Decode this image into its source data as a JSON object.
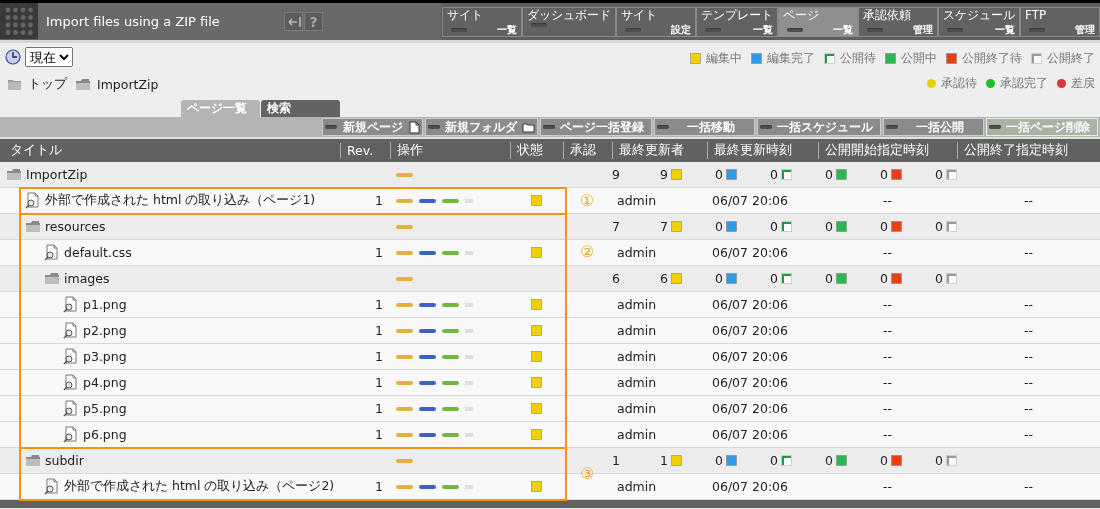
{
  "window": {
    "title": "Import files using a ZIP file",
    "help_label": "?"
  },
  "nav": [
    {
      "top": "サイト",
      "bottom": "一覧",
      "selected": false
    },
    {
      "top": "ダッシュボード",
      "selected": false
    },
    {
      "top": "サイト",
      "bottom": "設定",
      "selected": false
    },
    {
      "top": "テンプレート",
      "bottom": "一覧",
      "selected": false
    },
    {
      "top": "ページ",
      "bottom": "一覧",
      "selected": true
    },
    {
      "top": "承認依頼",
      "bottom": "管理",
      "selected": false
    },
    {
      "top": "スケジュール",
      "bottom": "一覧",
      "selected": false
    },
    {
      "top": "FTP",
      "bottom": "管理",
      "selected": false
    }
  ],
  "time_select": {
    "value": "現在"
  },
  "breadcrumbs": [
    {
      "label": "トップ",
      "kind": "closed"
    },
    {
      "label": "ImportZip",
      "kind": "open"
    }
  ],
  "legend": {
    "states": [
      {
        "label": "編集中",
        "color": "#f2d000",
        "kind": "square"
      },
      {
        "label": "編集完了",
        "color": "#2f9be6",
        "kind": "square"
      },
      {
        "label": "公開待",
        "color": "#1f9a40",
        "kind": "corner"
      },
      {
        "label": "公開中",
        "color": "#2fb552",
        "kind": "square"
      },
      {
        "label": "公開終了待",
        "color": "#e8400e",
        "kind": "square"
      },
      {
        "label": "公開終了",
        "color": "#999999",
        "kind": "corner"
      }
    ],
    "approvals": [
      {
        "label": "承認待",
        "color": "#e6d000"
      },
      {
        "label": "承認完了",
        "color": "#1fbf2a"
      },
      {
        "label": "差戻",
        "color": "#d83a3a"
      }
    ]
  },
  "tabs": [
    {
      "label": "ページ一覧",
      "selected": true
    },
    {
      "label": "検索",
      "selected": false
    }
  ],
  "toolbar": [
    {
      "label": "新規ページ",
      "kind": "new-page",
      "highlighted": false
    },
    {
      "label": "新規フォルダ",
      "kind": "new-folder",
      "highlighted": false
    },
    {
      "label": "ページ一括登録",
      "highlighted": false
    },
    {
      "label": "一括移動",
      "highlighted": false
    },
    {
      "label": "一括スケジュール",
      "highlighted": false
    },
    {
      "label": "一括公開",
      "highlighted": false
    },
    {
      "label": "一括ページ削除",
      "highlighted": true
    }
  ],
  "table": {
    "columns": [
      "タイトル",
      "Rev.",
      "操作",
      "状態",
      "承認",
      "最終更新者",
      "最終更新時刻",
      "公開開始指定時刻",
      "公開終了指定時刻"
    ],
    "rows": [
      {
        "kind": "folder",
        "title": "ImportZip",
        "total": "9",
        "counts": [
          {
            "count": "9",
            "color": "#f2d000",
            "kind": "square"
          },
          {
            "count": "0",
            "color": "#2f9be6",
            "kind": "square"
          },
          {
            "count": "0",
            "color": "#1f9a40",
            "kind": "corner"
          },
          {
            "count": "0",
            "color": "#2fb552",
            "kind": "square"
          },
          {
            "count": "0",
            "color": "#e8400e",
            "kind": "square"
          },
          {
            "count": "0",
            "color": "#999999",
            "kind": "corner"
          }
        ],
        "children": [
          {
            "kind": "page",
            "title": "外部で作成された html の取り込み（ページ1)",
            "rev": "1",
            "color": "#f2d000",
            "updater": "admin",
            "updated": "06/07 20:06",
            "publish_start": "--",
            "publish_end": "--",
            "callout": "①"
          },
          {
            "kind": "folder",
            "title": "resources",
            "total": "7",
            "callout": "②",
            "counts": [
              {
                "count": "7",
                "color": "#f2d000",
                "kind": "square"
              },
              {
                "count": "0",
                "color": "#2f9be6",
                "kind": "square"
              },
              {
                "count": "0",
                "color": "#1f9a40",
                "kind": "corner"
              },
              {
                "count": "0",
                "color": "#2fb552",
                "kind": "square"
              },
              {
                "count": "0",
                "color": "#e8400e",
                "kind": "square"
              },
              {
                "count": "0",
                "color": "#999999",
                "kind": "corner"
              }
            ],
            "children": [
              {
                "kind": "page",
                "title": "default.css",
                "rev": "1",
                "color": "#f2d000",
                "updater": "admin",
                "updated": "06/07 20:06",
                "publish_start": "--",
                "publish_end": "--"
              },
              {
                "kind": "folder",
                "title": "images",
                "total": "6",
                "counts": [
                  {
                    "count": "6",
                    "color": "#f2d000",
                    "kind": "square"
                  },
                  {
                    "count": "0",
                    "color": "#2f9be6",
                    "kind": "square"
                  },
                  {
                    "count": "0",
                    "color": "#1f9a40",
                    "kind": "corner"
                  },
                  {
                    "count": "0",
                    "color": "#2fb552",
                    "kind": "square"
                  },
                  {
                    "count": "0",
                    "color": "#e8400e",
                    "kind": "square"
                  },
                  {
                    "count": "0",
                    "color": "#999999",
                    "kind": "corner"
                  }
                ],
                "children": [
                  {
                    "kind": "page",
                    "title": "p1.png",
                    "rev": "1",
                    "color": "#f2d000",
                    "updater": "admin",
                    "updated": "06/07 20:06",
                    "publish_start": "--",
                    "publish_end": "--"
                  },
                  {
                    "kind": "page",
                    "title": "p2.png",
                    "rev": "1",
                    "color": "#f2d000",
                    "updater": "admin",
                    "updated": "06/07 20:06",
                    "publish_start": "--",
                    "publish_end": "--"
                  },
                  {
                    "kind": "page",
                    "title": "p3.png",
                    "rev": "1",
                    "color": "#f2d000",
                    "updater": "admin",
                    "updated": "06/07 20:06",
                    "publish_start": "--",
                    "publish_end": "--"
                  },
                  {
                    "kind": "page",
                    "title": "p4.png",
                    "rev": "1",
                    "color": "#f2d000",
                    "updater": "admin",
                    "updated": "06/07 20:06",
                    "publish_start": "--",
                    "publish_end": "--"
                  },
                  {
                    "kind": "page",
                    "title": "p5.png",
                    "rev": "1",
                    "color": "#f2d000",
                    "updater": "admin",
                    "updated": "06/07 20:06",
                    "publish_start": "--",
                    "publish_end": "--"
                  },
                  {
                    "kind": "page",
                    "title": "p6.png",
                    "rev": "1",
                    "color": "#f2d000",
                    "updater": "admin",
                    "updated": "06/07 20:06",
                    "publish_start": "--",
                    "publish_end": "--"
                  }
                ]
              }
            ]
          },
          {
            "kind": "folder",
            "title": "subdir",
            "total": "1",
            "callout": "③",
            "counts": [
              {
                "count": "1",
                "color": "#f2d000",
                "kind": "square"
              },
              {
                "count": "0",
                "color": "#2f9be6",
                "kind": "square"
              },
              {
                "count": "0",
                "color": "#1f9a40",
                "kind": "corner"
              },
              {
                "count": "0",
                "color": "#2fb552",
                "kind": "square"
              },
              {
                "count": "0",
                "color": "#e8400e",
                "kind": "square"
              },
              {
                "count": "0",
                "color": "#999999",
                "kind": "corner"
              }
            ],
            "children": [
              {
                "kind": "page",
                "title": "外部で作成された html の取り込み（ページ2)",
                "rev": "1",
                "color": "#f2d000",
                "updater": "admin",
                "updated": "06/07 20:06",
                "publish_start": "--",
                "publish_end": "--"
              }
            ]
          }
        ]
      }
    ]
  }
}
